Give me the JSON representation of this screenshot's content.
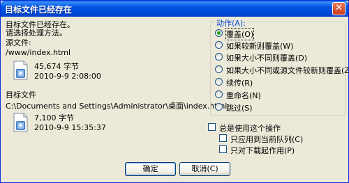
{
  "dialog": {
    "title": "目标文件已经存在",
    "close_glyph": "✕",
    "message_line1": "目标文件已经存在。",
    "message_line2": "请选择处理方法。"
  },
  "source": {
    "label": "源文件:",
    "path": "/www/index.html",
    "size": "45,674 字节",
    "date": "2010-9-9 2:08:00",
    "icon": "document-icon"
  },
  "target": {
    "label": "目标文件",
    "path": "C:\\Documents and Settings\\Administrator\\桌面\\index.html",
    "size": "7,100 字节",
    "date": "2010-9-9 15:35:37",
    "icon": "document-icon"
  },
  "actions": {
    "legend": "动作(A):",
    "selected_index": 0,
    "options": [
      "覆盖(O)",
      "如果较新则覆盖(W)",
      "如果大小不同则覆盖(D)",
      "如果大小不同或源文件较新则覆盖(Z)",
      "续传(R)",
      "重命名(N)",
      "跳过(S)"
    ]
  },
  "options": {
    "always_use": "总是使用这个操作",
    "apply_queue": "只应用到当前队列(C)",
    "apply_download": "只对下载起作用(P)"
  },
  "buttons": {
    "ok": "确定",
    "cancel": "取消(C)"
  },
  "colors": {
    "accent": "#0054e3",
    "legend": "#0046d5",
    "dialog_bg": "#ece9d8"
  }
}
